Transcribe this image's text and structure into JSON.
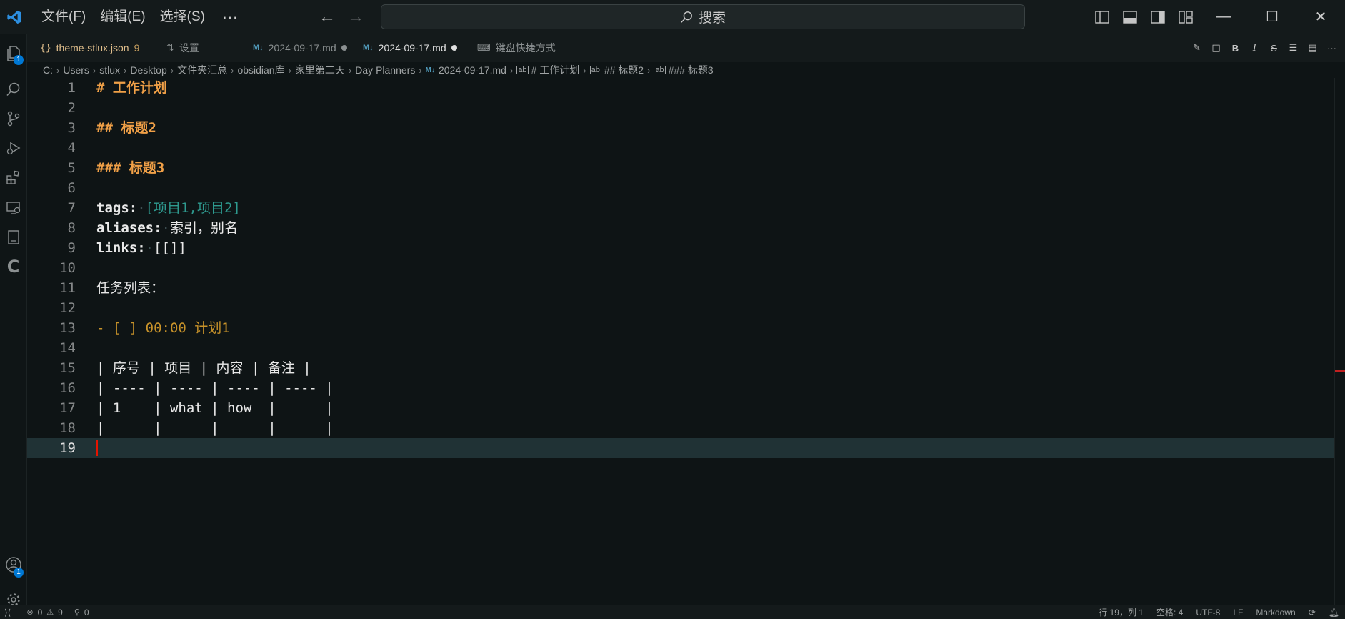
{
  "menu": {
    "file": "文件(F)",
    "edit": "编辑(E)",
    "selection": "选择(S)",
    "more": "···"
  },
  "search": {
    "label": "搜索"
  },
  "activity": {
    "explorer_badge": "1",
    "accounts_badge": "1"
  },
  "tabs": [
    {
      "label": "theme-stlux.json",
      "badge": "9",
      "color": "#e2c08d"
    },
    {
      "label": "设置"
    },
    {
      "label": "2024-09-17.md"
    },
    {
      "label": "2024-09-17.md"
    },
    {
      "label": "键盘快捷方式"
    }
  ],
  "breadcrumb": [
    "C:",
    "Users",
    "stlux",
    "Desktop",
    "文件夹汇总",
    "obsidian库",
    "家里第二天",
    "Day Planners",
    "2024-09-17.md",
    "# 工作计划",
    "## 标题2",
    "### 标题3"
  ],
  "editor": {
    "line_numbers": [
      "1",
      "2",
      "3",
      "4",
      "5",
      "6",
      "7",
      "8",
      "9",
      "10",
      "11",
      "12",
      "13",
      "14",
      "15",
      "16",
      "17",
      "18",
      "19"
    ],
    "l1": "# 工作计划",
    "l3": "## 标题2",
    "l5": "### 标题3",
    "l7_key": "tags:",
    "l7_val": "[项目1,项目2]",
    "l8_key": "aliases:",
    "l8_val": "索引，别名",
    "l9_key": "links:",
    "l9_val": "[[]]",
    "l11": "任务列表：",
    "l13": "- [ ] 00:00 计划1",
    "l15": "| 序号 | 项目 | 内容 | 备注 |",
    "l16": "| ---- | ---- | ---- | ---- |",
    "l17": "| 1    | what | how  |      |",
    "l18": "|      |      |      |      |"
  },
  "status": {
    "errors": "0",
    "warnings": "9",
    "ports": "0",
    "position": "行 19，列 1",
    "spaces": "空格: 4",
    "encoding": "UTF-8",
    "eol": "LF",
    "language": "Markdown"
  }
}
